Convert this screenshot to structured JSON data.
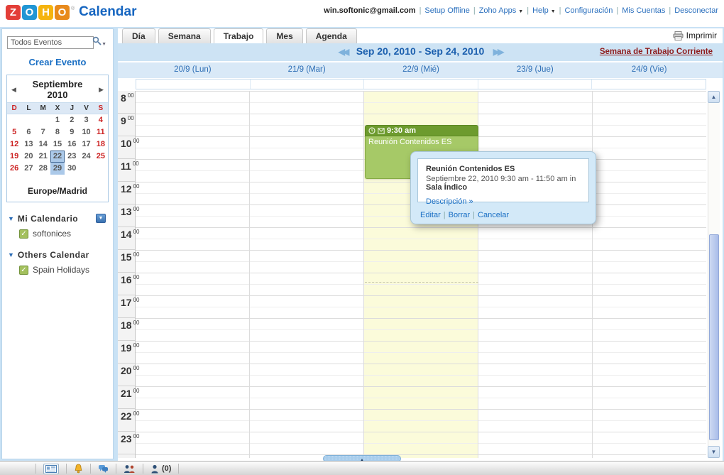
{
  "header": {
    "logo_letters": [
      "Z",
      "O",
      "H",
      "O"
    ],
    "logo_tile_colors": [
      "#e33e38",
      "#2196d4",
      "#f5b40f",
      "#e88a1c"
    ],
    "registered_mark": "®",
    "product": "Calendar",
    "email": "win.softonic@gmail.com",
    "links": [
      {
        "label": "Setup Offline",
        "caret": false
      },
      {
        "label": "Zoho Apps",
        "caret": true
      },
      {
        "label": "Help",
        "caret": true
      },
      {
        "label": "Configuración",
        "caret": false
      },
      {
        "label": "Mis Cuentas",
        "caret": false
      },
      {
        "label": "Desconectar",
        "caret": false
      }
    ],
    "separator": "|"
  },
  "sidebar": {
    "search_value": "Todos Eventos",
    "create_event": "Crear Evento",
    "mini_calendar": {
      "title": "Septiembre 2010",
      "day_headers": [
        "D",
        "L",
        "M",
        "X",
        "J",
        "V",
        "S"
      ],
      "weeks": [
        [
          "",
          "",
          "",
          "1",
          "2",
          "3",
          "4"
        ],
        [
          "5",
          "6",
          "7",
          "8",
          "9",
          "10",
          "11"
        ],
        [
          "12",
          "13",
          "14",
          "15",
          "16",
          "17",
          "18"
        ],
        [
          "19",
          "20",
          "21",
          "22",
          "23",
          "24",
          "25"
        ],
        [
          "26",
          "27",
          "28",
          "29",
          "30",
          "",
          ""
        ]
      ],
      "selected_day": "22",
      "shaded_day": "29",
      "timezone": "Europe/Madrid"
    },
    "my_calendar_label": "Mi Calendario",
    "my_calendars": [
      "softonices"
    ],
    "others_label": "Others Calendar",
    "other_calendars": [
      "Spain Holidays"
    ]
  },
  "tabs": {
    "items": [
      "Día",
      "Semana",
      "Trabajo",
      "Mes",
      "Agenda"
    ],
    "active": "Trabajo"
  },
  "toolbar": {
    "print_label": "Imprimir"
  },
  "nav": {
    "range": "Sep 20, 2010 - Sep 24, 2010",
    "current_week": "Semana de Trabajo Corriente"
  },
  "grid": {
    "day_headers": [
      "20/9 (Lun)",
      "21/9 (Mar)",
      "22/9 (Mié)",
      "23/9 (Jue)",
      "24/9 (Vie)"
    ],
    "today_index": 2,
    "hours": [
      "8",
      "9",
      "10",
      "11",
      "12",
      "13",
      "14",
      "15",
      "16",
      "17",
      "18",
      "19",
      "20",
      "21",
      "22",
      "23"
    ],
    "minutes_label": "00"
  },
  "event": {
    "time": "9:30 am",
    "title": "Reunión Contenidos ES"
  },
  "popup": {
    "title": "Reunión Contenidos ES",
    "when": "Septiembre 22, 2010 9:30 am - 11:50 am in",
    "location": "Sala Índico",
    "description_link": "Descripción »",
    "actions": [
      "Editar",
      "Borrar",
      "Cancelar"
    ],
    "action_separator": "|"
  },
  "statusbar": {
    "presence_count": "(0)"
  },
  "icons": {
    "prev": "◀◀",
    "next": "▶▶",
    "minical_prev": "◀",
    "minical_next": "▶",
    "caret_down": "▼",
    "collapse_up": "▲",
    "check": "✓",
    "section_bullet": "▼"
  },
  "colors": {
    "accent_blue": "#1a6fc4",
    "nav_bar": "#cde3f4",
    "today_column": "#fbfbda",
    "event_dark_green": "#6d9b2e",
    "event_light_green": "#a6c967",
    "current_week_link": "#8e1b1b",
    "weekend_red": "#cc2222"
  }
}
